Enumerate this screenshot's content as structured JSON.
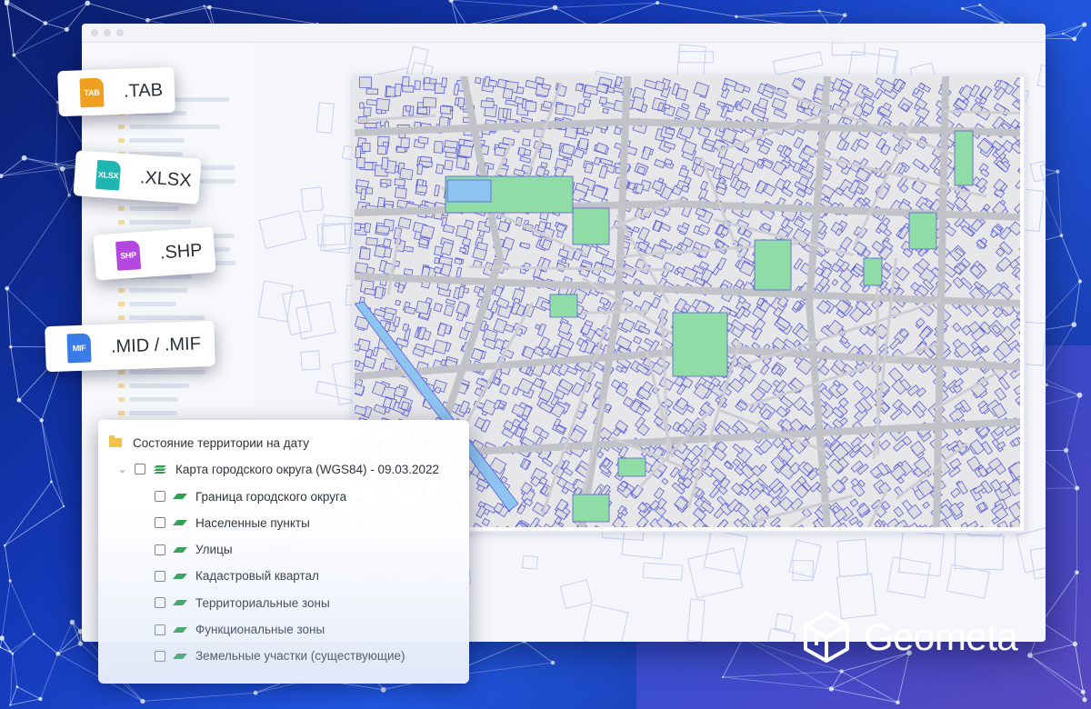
{
  "formats": [
    {
      "label": ".TAB",
      "icon": "tab-file-icon",
      "icon_text": "TAB",
      "color": "#f0a020"
    },
    {
      "label": ".XLSX",
      "icon": "xlsx-file-icon",
      "icon_text": "XLSX",
      "color": "#1fb5b0"
    },
    {
      "label": ".SHP",
      "icon": "shp-file-icon",
      "icon_text": "SHP",
      "color": "#b447e0"
    },
    {
      "label": ".MID / .MIF",
      "icon": "mif-file-icon",
      "icon_text": "MIF",
      "color": "#3a7be8"
    }
  ],
  "layers": {
    "root": {
      "label": "Состояние территории на дату",
      "icon": "folder-icon"
    },
    "map": {
      "label": "Карта городского округа (WGS84) - 09.03.2022",
      "icon": "layer-group-icon"
    },
    "items": [
      {
        "label": "Граница городского округа"
      },
      {
        "label": "Населенные  пункты"
      },
      {
        "label": "Улицы"
      },
      {
        "label": "Кадастровый квартал"
      },
      {
        "label": "Территориальные зоны"
      },
      {
        "label": "Функциональные зоны"
      },
      {
        "label": "Земельные участки (существующие)"
      }
    ]
  },
  "brand": {
    "name": "Geometa",
    "icon": "geometa-cube-logo"
  },
  "colors": {
    "background": "#1438b8",
    "map_lines": "#5b5fd9",
    "park": "#8fdca6",
    "water": "#8ec4f2",
    "layer_green": "#2e9f4e"
  }
}
